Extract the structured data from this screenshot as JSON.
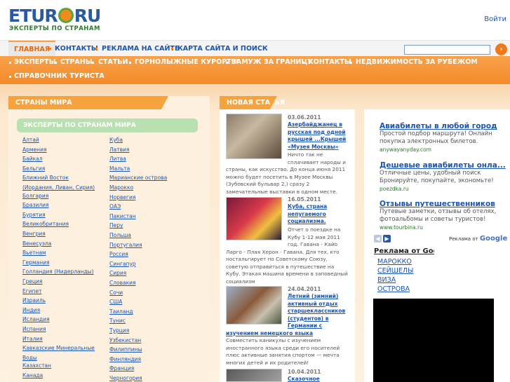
{
  "header": {
    "logo_brand_left": "ETUR",
    "logo_brand_right": "RU",
    "logo_tagline": "ЭКСПЕРТЫ ПО СТРАНАМ",
    "login_label": "Войти"
  },
  "top_nav": {
    "items": [
      "ГЛАВНАЯ",
      "КОНТАКТЫ",
      "РЕКЛАМА НА САЙТЕ",
      "КАРТА САЙТА И ПОИСК"
    ],
    "active_index": 0,
    "search_value": "",
    "search_button": "›"
  },
  "orange_nav": {
    "items": [
      "ЭКСПЕРТЫ",
      "СТРАНЫ",
      "СТАТЬИ",
      "ГОРНОЛЫЖНЫЕ КУРОРТЫ",
      "ЗАМУЖ ЗА ГРАНИЦУ",
      "КОНТАКТЫ",
      "НЕДВИЖИМОСТЬ ЗА РУБЕЖОМ",
      "СПРАВОЧНИК ТУРИСТА"
    ]
  },
  "left": {
    "heading": "СТРАНЫ МИРА",
    "experts_label": "ЭКСПЕРТЫ ПО СТРАНАМ МИРА",
    "col1": [
      "Алтай",
      "Армения",
      "Байкал",
      "Бельгия",
      "Ближний Восток",
      "(Иордания, Ливан, Сирия)",
      "Болгария",
      "Бразилия",
      "Бурятия",
      "Великобритания",
      "Венгрия",
      "Венесуэла",
      "Вьетнам",
      "Германия",
      "Голландия (Нидерланды)",
      "Греция",
      "Египет",
      "Израиль",
      "Индия",
      "Исландия",
      "Испания",
      "Италия",
      "Кавказские Минеральные",
      "Воды",
      "Казахстан",
      "Канада"
    ],
    "col2": [
      "Куба",
      "Латвия",
      "Литва",
      "Мальта",
      "Марианские острова",
      "Марокко",
      "Норвегия",
      "ОАЭ",
      "Пакистан",
      "Перу",
      "Польша",
      "Португалия",
      "Россия",
      "Сингапур",
      "Сирия",
      "Словакия",
      "Сочи",
      "США",
      "Таиланд",
      "Тунис",
      "Турция",
      "Узбекистан",
      "Филиппины",
      "Финляндия",
      "Франция",
      "Черногория"
    ]
  },
  "middle": {
    "heading": "НОВАЯ СТАТЬЯ",
    "articles": [
      {
        "date": "03.06.2011",
        "title": [
          "Азербайджанец в",
          "русская под одной",
          "крышей ...Крышей",
          "«Музея Москвы»"
        ],
        "text": [
          "Ничто так не",
          "сплачивает народы и",
          "страны, как искусство. До конца июня 2011",
          "можно будет посетить в Музее Москвы",
          "(Зубовский бульвар 2,) сразу 2",
          "замечательные выставки в одном месте."
        ]
      },
      {
        "date": "16.05.2011",
        "title": [
          "Куба, страна",
          "непугаемого",
          "социализма."
        ],
        "text": [
          "Отчет о поездке на",
          "Кубу 1-12 мая 2011",
          "год. Гавана - Кайо",
          "Ларго - Плая Херон - Гавана. Для тех, кто",
          "ностальгирует по Советскому Союзу,",
          "советую отправиться в путешествие на",
          "Кубу. Этакая машина времени в заповедный",
          "социализм"
        ]
      },
      {
        "date": "24.04.2011",
        "title": [
          "Летний (зимний)",
          "активный отдых",
          "старшеклассников",
          "(студентов) в",
          "Германии с",
          "изучением немецкого языка"
        ],
        "text": [
          "Совместить каникулы с изучением",
          "иностранного языка среди его носителей",
          "плюс активные занятия спортом — мечта",
          "многих детей и их родителей!"
        ]
      },
      {
        "date": "10.04.2011",
        "title": [
          "Сказочное"
        ],
        "text": []
      }
    ]
  },
  "right": {
    "ads": [
      {
        "title": "Авиабилеты в любой город",
        "text": [
          "Простой подбор маршрута! Онлайн",
          "покупка электронных билетов."
        ],
        "url": "anywayanyday.com"
      },
      {
        "title": "Дешевые авиабилеты онла...",
        "text": [
          "Отличные цены, удобный поиск",
          "Бронируйте, покупайте, экономьте!"
        ],
        "url": "poezdka.ru"
      },
      {
        "title": "Отзывы путешественников",
        "text": [
          "Путевые заметки, отзывы об отелях,",
          "фотоальбомы и советы туристов!"
        ],
        "url": "www.tourbina.ru"
      }
    ],
    "ads_by": "Реклама от",
    "ads_by_brand": "Google",
    "google_heading": "Реклама от Goog",
    "google_links": [
      "МАРОККО",
      "СЕЙШЕЛЫ",
      "ВИЗА",
      "ОСТРОВА"
    ],
    "colors": {
      "accent": "#f7a23c",
      "link": "#1a55b3",
      "video": "#000000"
    }
  }
}
